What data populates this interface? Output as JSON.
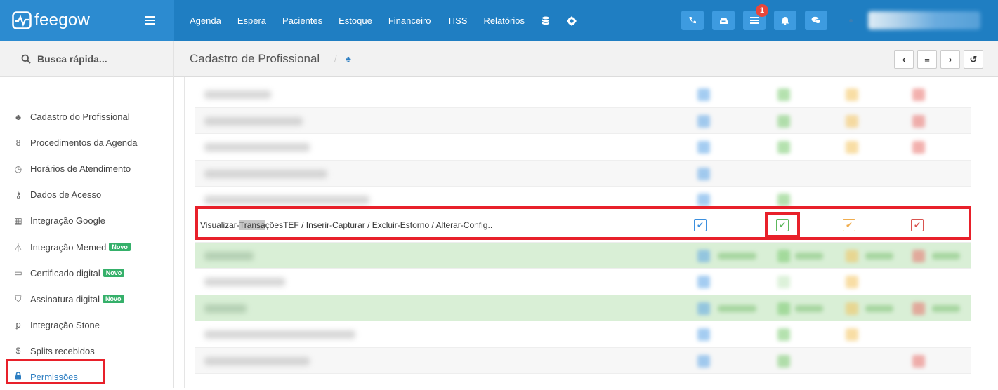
{
  "brand": {
    "name": "feegow"
  },
  "nav": {
    "items": [
      "Agenda",
      "Espera",
      "Pacientes",
      "Estoque",
      "Financeiro",
      "TISS",
      "Relatórios"
    ],
    "icons": [
      "database-icon",
      "gear-icon"
    ]
  },
  "toolbar": {
    "buttons": [
      "phone-icon",
      "inbox-icon",
      "list-icon",
      "bell-icon",
      "chat-icon"
    ],
    "notification_count": "1"
  },
  "search": {
    "label": "Busca rápida..."
  },
  "sidebar": {
    "items": [
      {
        "label": "Cadastro do Profissional",
        "icon": "user-md-icon"
      },
      {
        "label": "Procedimentos da Agenda",
        "icon": "stethoscope-icon"
      },
      {
        "label": "Horários de Atendimento",
        "icon": "clock-icon"
      },
      {
        "label": "Dados de Acesso",
        "icon": "key-icon"
      },
      {
        "label": "Integração Google",
        "icon": "calendar-icon"
      },
      {
        "label": "Integração Memed",
        "icon": "flask-icon",
        "badge": "Novo"
      },
      {
        "label": "Certificado digital",
        "icon": "credit-card-icon",
        "badge": "Novo"
      },
      {
        "label": "Assinatura digital",
        "icon": "shield-icon",
        "badge": "Novo"
      },
      {
        "label": "Integração Stone",
        "icon": "stone-icon"
      },
      {
        "label": "Splits recebidos",
        "icon": "dollar-icon"
      },
      {
        "label": "Permissões",
        "icon": "lock-icon"
      }
    ]
  },
  "header": {
    "title": "Cadastro de Profissional",
    "separator": "/"
  },
  "permission_row": {
    "prefix": "Visualizar-",
    "highlight": "Transa",
    "suffix": "çõesTEF / Inserir-Capturar / Excluir-Estorno / Alterar-Config..",
    "checkmark": "✔"
  },
  "colors": {
    "topbar": "#1f7ec2",
    "brand": "#2c8bd0",
    "annotation": "#e8202a"
  }
}
